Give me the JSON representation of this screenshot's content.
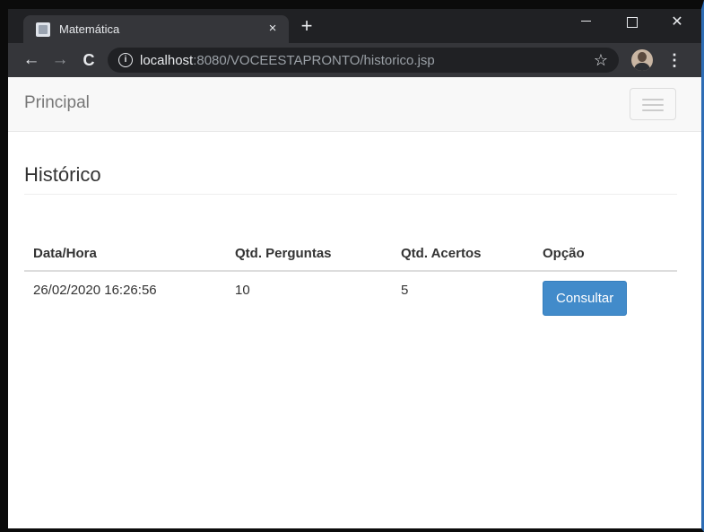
{
  "browser": {
    "tab_title": "Matemática",
    "tab_close": "×",
    "new_tab": "+",
    "window_close": "✕",
    "url_host": "localhost",
    "url_rest": ":8080/VOCEESTAPRONTO/historico.jsp",
    "back": "←",
    "forward": "→",
    "reload": "C",
    "star": "☆",
    "menu": "⋮",
    "info": "i"
  },
  "navbar": {
    "brand": "Principal"
  },
  "page": {
    "title": "Histórico"
  },
  "table": {
    "headers": [
      "Data/Hora",
      "Qtd. Perguntas",
      "Qtd. Acertos",
      "Opção"
    ],
    "rows": [
      {
        "datetime": "26/02/2020 16:26:56",
        "questions": "10",
        "correct": "5",
        "action_label": "Consultar"
      }
    ]
  },
  "colors": {
    "primary_button": "#428bca",
    "browser_dark": "#202124",
    "browser_toolbar": "#35363a"
  },
  "icons": [
    "favicon-icon",
    "close-icon",
    "plus-icon",
    "minimize-icon",
    "maximize-icon",
    "back-arrow-icon",
    "forward-arrow-icon",
    "reload-icon",
    "info-icon",
    "star-icon",
    "avatar",
    "kebab-menu-icon",
    "hamburger-icon"
  ]
}
